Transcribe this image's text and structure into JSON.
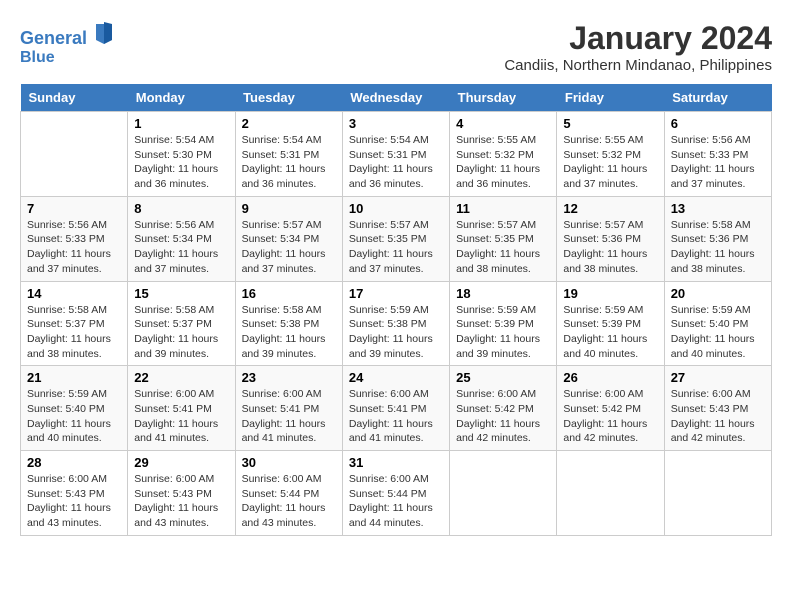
{
  "header": {
    "logo_line1": "General",
    "logo_line2": "Blue",
    "month": "January 2024",
    "location": "Candiis, Northern Mindanao, Philippines"
  },
  "days_of_week": [
    "Sunday",
    "Monday",
    "Tuesday",
    "Wednesday",
    "Thursday",
    "Friday",
    "Saturday"
  ],
  "weeks": [
    [
      {
        "day": "",
        "info": ""
      },
      {
        "day": "1",
        "info": "Sunrise: 5:54 AM\nSunset: 5:30 PM\nDaylight: 11 hours\nand 36 minutes."
      },
      {
        "day": "2",
        "info": "Sunrise: 5:54 AM\nSunset: 5:31 PM\nDaylight: 11 hours\nand 36 minutes."
      },
      {
        "day": "3",
        "info": "Sunrise: 5:54 AM\nSunset: 5:31 PM\nDaylight: 11 hours\nand 36 minutes."
      },
      {
        "day": "4",
        "info": "Sunrise: 5:55 AM\nSunset: 5:32 PM\nDaylight: 11 hours\nand 36 minutes."
      },
      {
        "day": "5",
        "info": "Sunrise: 5:55 AM\nSunset: 5:32 PM\nDaylight: 11 hours\nand 37 minutes."
      },
      {
        "day": "6",
        "info": "Sunrise: 5:56 AM\nSunset: 5:33 PM\nDaylight: 11 hours\nand 37 minutes."
      }
    ],
    [
      {
        "day": "7",
        "info": "Sunrise: 5:56 AM\nSunset: 5:33 PM\nDaylight: 11 hours\nand 37 minutes."
      },
      {
        "day": "8",
        "info": "Sunrise: 5:56 AM\nSunset: 5:34 PM\nDaylight: 11 hours\nand 37 minutes."
      },
      {
        "day": "9",
        "info": "Sunrise: 5:57 AM\nSunset: 5:34 PM\nDaylight: 11 hours\nand 37 minutes."
      },
      {
        "day": "10",
        "info": "Sunrise: 5:57 AM\nSunset: 5:35 PM\nDaylight: 11 hours\nand 37 minutes."
      },
      {
        "day": "11",
        "info": "Sunrise: 5:57 AM\nSunset: 5:35 PM\nDaylight: 11 hours\nand 38 minutes."
      },
      {
        "day": "12",
        "info": "Sunrise: 5:57 AM\nSunset: 5:36 PM\nDaylight: 11 hours\nand 38 minutes."
      },
      {
        "day": "13",
        "info": "Sunrise: 5:58 AM\nSunset: 5:36 PM\nDaylight: 11 hours\nand 38 minutes."
      }
    ],
    [
      {
        "day": "14",
        "info": "Sunrise: 5:58 AM\nSunset: 5:37 PM\nDaylight: 11 hours\nand 38 minutes."
      },
      {
        "day": "15",
        "info": "Sunrise: 5:58 AM\nSunset: 5:37 PM\nDaylight: 11 hours\nand 39 minutes."
      },
      {
        "day": "16",
        "info": "Sunrise: 5:58 AM\nSunset: 5:38 PM\nDaylight: 11 hours\nand 39 minutes."
      },
      {
        "day": "17",
        "info": "Sunrise: 5:59 AM\nSunset: 5:38 PM\nDaylight: 11 hours\nand 39 minutes."
      },
      {
        "day": "18",
        "info": "Sunrise: 5:59 AM\nSunset: 5:39 PM\nDaylight: 11 hours\nand 39 minutes."
      },
      {
        "day": "19",
        "info": "Sunrise: 5:59 AM\nSunset: 5:39 PM\nDaylight: 11 hours\nand 40 minutes."
      },
      {
        "day": "20",
        "info": "Sunrise: 5:59 AM\nSunset: 5:40 PM\nDaylight: 11 hours\nand 40 minutes."
      }
    ],
    [
      {
        "day": "21",
        "info": "Sunrise: 5:59 AM\nSunset: 5:40 PM\nDaylight: 11 hours\nand 40 minutes."
      },
      {
        "day": "22",
        "info": "Sunrise: 6:00 AM\nSunset: 5:41 PM\nDaylight: 11 hours\nand 41 minutes."
      },
      {
        "day": "23",
        "info": "Sunrise: 6:00 AM\nSunset: 5:41 PM\nDaylight: 11 hours\nand 41 minutes."
      },
      {
        "day": "24",
        "info": "Sunrise: 6:00 AM\nSunset: 5:41 PM\nDaylight: 11 hours\nand 41 minutes."
      },
      {
        "day": "25",
        "info": "Sunrise: 6:00 AM\nSunset: 5:42 PM\nDaylight: 11 hours\nand 42 minutes."
      },
      {
        "day": "26",
        "info": "Sunrise: 6:00 AM\nSunset: 5:42 PM\nDaylight: 11 hours\nand 42 minutes."
      },
      {
        "day": "27",
        "info": "Sunrise: 6:00 AM\nSunset: 5:43 PM\nDaylight: 11 hours\nand 42 minutes."
      }
    ],
    [
      {
        "day": "28",
        "info": "Sunrise: 6:00 AM\nSunset: 5:43 PM\nDaylight: 11 hours\nand 43 minutes."
      },
      {
        "day": "29",
        "info": "Sunrise: 6:00 AM\nSunset: 5:43 PM\nDaylight: 11 hours\nand 43 minutes."
      },
      {
        "day": "30",
        "info": "Sunrise: 6:00 AM\nSunset: 5:44 PM\nDaylight: 11 hours\nand 43 minutes."
      },
      {
        "day": "31",
        "info": "Sunrise: 6:00 AM\nSunset: 5:44 PM\nDaylight: 11 hours\nand 44 minutes."
      },
      {
        "day": "",
        "info": ""
      },
      {
        "day": "",
        "info": ""
      },
      {
        "day": "",
        "info": ""
      }
    ]
  ]
}
